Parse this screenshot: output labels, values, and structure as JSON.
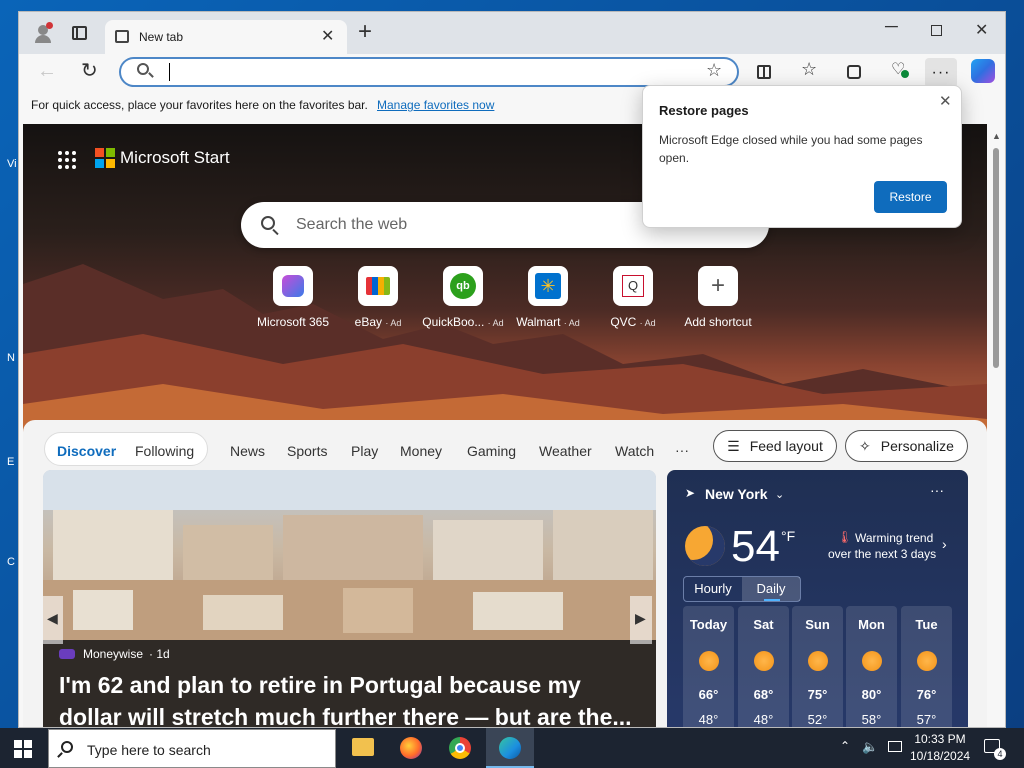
{
  "desktop": {
    "edge_marks": [
      "Vi",
      "N",
      "E",
      "C"
    ]
  },
  "browser": {
    "tab_title": "New tab",
    "address_value": "",
    "favbar_text": "For quick access, place your favorites here on the favorites bar.",
    "favbar_link": "Manage favorites now"
  },
  "start": {
    "brand": "Microsoft Start",
    "search_placeholder": "Search the web",
    "shortcuts": [
      {
        "label": "Microsoft 365",
        "ad": "",
        "icon": "microsoft-365-icon"
      },
      {
        "label": "eBay",
        "ad": "· Ad",
        "icon": "ebay-icon"
      },
      {
        "label": "QuickBoo...",
        "ad": "· Ad",
        "icon": "quickbooks-icon"
      },
      {
        "label": "Walmart",
        "ad": "· Ad",
        "icon": "walmart-icon"
      },
      {
        "label": "QVC",
        "ad": "· Ad",
        "icon": "qvc-icon"
      },
      {
        "label": "Add shortcut",
        "ad": "",
        "icon": "plus-icon"
      }
    ]
  },
  "feed": {
    "tabs": [
      "Discover",
      "Following",
      "News",
      "Sports",
      "Play",
      "Money",
      "Gaming",
      "Weather",
      "Watch",
      "···"
    ],
    "feed_layout": "Feed layout",
    "personalize": "Personalize",
    "article": {
      "source": "Moneywise",
      "age": "· 1d",
      "headline_line1": "I'm 62 and plan to retire in Portugal because my",
      "headline_line2": "dollar will stretch much further there — but are the..."
    }
  },
  "weather": {
    "location": "New York",
    "temp": "54",
    "unit": "°F",
    "trend_line1": "Warming trend",
    "trend_line2": "over the next 3 days",
    "toggle": [
      "Hourly",
      "Daily"
    ],
    "days": [
      {
        "name": "Today",
        "high": "66°",
        "low": "48°"
      },
      {
        "name": "Sat",
        "high": "68°",
        "low": "48°"
      },
      {
        "name": "Sun",
        "high": "75°",
        "low": "52°"
      },
      {
        "name": "Mon",
        "high": "80°",
        "low": "58°"
      },
      {
        "name": "Tue",
        "high": "76°",
        "low": "57°"
      }
    ]
  },
  "popup": {
    "title": "Restore pages",
    "body": "Microsoft Edge closed while you had some pages open.",
    "button": "Restore"
  },
  "taskbar": {
    "search_placeholder": "Type here to search",
    "time": "10:33 PM",
    "date": "10/18/2024",
    "notifications": "4"
  },
  "colors": {
    "accent": "#0f6cbd",
    "taskbar": "#1c2431",
    "discover": "#0f6cbd"
  }
}
